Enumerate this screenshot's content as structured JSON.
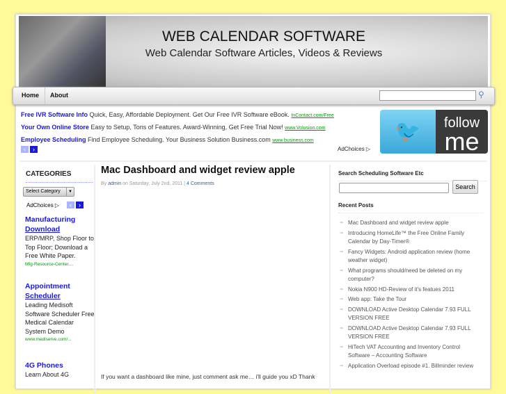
{
  "header": {
    "title": "WEB CALENDAR SOFTWARE",
    "description": "Web Calendar Software Articles, Videos & Reviews"
  },
  "nav": {
    "items": [
      "Home",
      "About"
    ],
    "search_icon": "search-icon"
  },
  "ads": [
    {
      "title": "Free IVR Software Info",
      "text": "Quick, Easy, Affordable Deployment. Get Our Free IVR Software eBook.",
      "url": "InContact.com/Free"
    },
    {
      "title": "Your Own Online Store",
      "text": "Easy to Setup, Tons of Features. Award-Winning, Get Free Trial Now!",
      "url": "www.Volusion.com"
    },
    {
      "title": "Employee Scheduling",
      "text": "Find Employee Scheduling. Your Business Solution Business.com",
      "url": "www.business.com"
    }
  ],
  "adchoices": "AdChoices ▷",
  "twitter": {
    "line1": "follow",
    "line2": "me"
  },
  "sidebar_left": {
    "heading": "CATEGORIES",
    "select": "Select Category",
    "adchoices": "AdChoices ▷",
    "ads": [
      {
        "title1": "Manufacturing",
        "title2": "Download",
        "text": "ERP/MRP, Shop Floor to Top Floor; Download a Free White Paper.",
        "url": "Mfg-Resource-Center...."
      },
      {
        "title1": "Appointment",
        "title2": "Scheduler",
        "text": "Leading Medisoft Software Scheduler Free Medical Calendar System Demo",
        "url": "www.mediserve.com/..."
      },
      {
        "title1": "4G Phones",
        "text": "Learn About 4G"
      }
    ]
  },
  "post": {
    "title": "Mac Dashboard and widget review apple",
    "by": "By",
    "author": "admin",
    "date": "on Saturday, July 2nd, 2011 |",
    "comments": "4 Comments",
    "excerpt": "If you want a dashboard like mine, just comment ask me… i'll guide you xD Thank"
  },
  "sidebar_right": {
    "search_heading": "Search Scheduling Software Etc",
    "search_button": "Search",
    "recent_heading": "Recent Posts",
    "recent": [
      "Mac Dashboard and widget review apple",
      "Introducing HomeLife™ the Free Online Family Calendar by Day-Timer®",
      "Fancy Widgets: Android application review (home weather widget)",
      "What programs should/need be deleted on my computer?",
      "Nokia N900 HD-Review of it's featues 2011",
      "Web app: Take the Tour",
      "DOWNLOAD Active Desktop Calendar 7.93 FULL VERSION FREE",
      "DOWNLOAD Active Desktop Calendar 7.93 FULL VERSION FREE",
      "HiTech VAT Accounting and Inventory Control Software – Accounting Software",
      "Application Overload episode #1. Billminder review"
    ]
  }
}
